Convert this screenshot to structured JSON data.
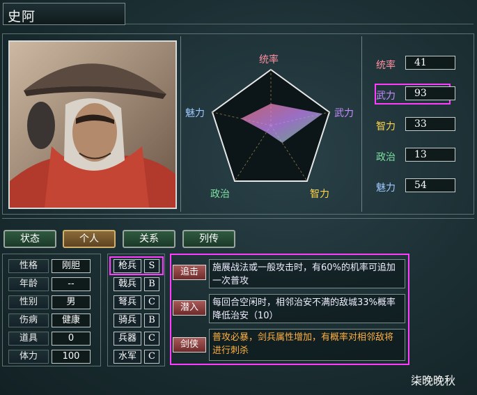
{
  "character": {
    "name": "史阿"
  },
  "radar": {
    "labels": {
      "lead": "统率",
      "war": "武力",
      "int": "智力",
      "pol": "政治",
      "cha": "魅力"
    },
    "label_colors": {
      "lead": "#ff8fa0",
      "war": "#c68cff",
      "int": "#ffd54a",
      "pol": "#7ee0a0",
      "cha": "#9ec8ff"
    }
  },
  "stats": [
    {
      "label": "统率",
      "value": "41",
      "color": "#ff8fa0"
    },
    {
      "label": "武力",
      "value": "93",
      "color": "#c68cff"
    },
    {
      "label": "智力",
      "value": "33",
      "color": "#ffd54a"
    },
    {
      "label": "政治",
      "value": "13",
      "color": "#7ee0a0"
    },
    {
      "label": "魅力",
      "value": "54",
      "color": "#9ec8ff"
    }
  ],
  "tabs": [
    {
      "label": "状态",
      "active": false
    },
    {
      "label": "个人",
      "active": true
    },
    {
      "label": "关系",
      "active": false
    },
    {
      "label": "列传",
      "active": false
    }
  ],
  "personal": [
    {
      "label": "性格",
      "value": "刚胆"
    },
    {
      "label": "年龄",
      "value": "--"
    },
    {
      "label": "性别",
      "value": "男"
    },
    {
      "label": "伤病",
      "value": "健康"
    },
    {
      "label": "道具",
      "value": "0"
    },
    {
      "label": "体力",
      "value": "100"
    }
  ],
  "troops": [
    {
      "label": "枪兵",
      "grade": "S"
    },
    {
      "label": "戟兵",
      "grade": "B"
    },
    {
      "label": "弩兵",
      "grade": "C"
    },
    {
      "label": "骑兵",
      "grade": "B"
    },
    {
      "label": "兵器",
      "grade": "C"
    },
    {
      "label": "水军",
      "grade": "C"
    }
  ],
  "skills": [
    {
      "name": "追击",
      "desc": "施展战法或一般攻击时，有60%的机率可追加一次普攻",
      "desc_color": "#eef6f6"
    },
    {
      "name": "潜入",
      "desc": "每回合空闲时，相邻治安不满的敌城33%概率降低治安（10）",
      "desc_color": "#eef6f6"
    },
    {
      "name": "剑侠",
      "desc": "普攻必暴，剑兵属性增加，有概率对相邻敌将进行刺杀",
      "desc_color": "#ffb040"
    }
  ],
  "watermark": "柒晚晚秋"
}
